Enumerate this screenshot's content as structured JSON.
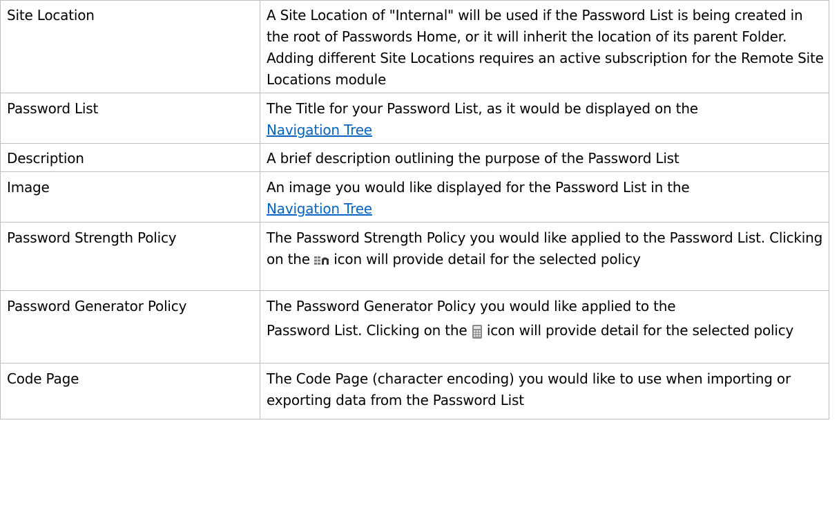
{
  "rows": [
    {
      "field": "Site Location",
      "description": "A Site Location of \"Internal\" will be used if the Password List is being created in the root of Passwords Home, or it will inherit the location of its parent Folder. Adding different Site Locations requires an active subscription for the Remote Site Locations module"
    },
    {
      "field": "Password List",
      "description_before": "The Title for your Password List, as it would be displayed on the",
      "link": "Navigation Tree"
    },
    {
      "field": "Description",
      "description": "A brief description outlining the purpose of the Password List"
    },
    {
      "field": "Image",
      "description_before": "An image you would like displayed for the Password List in the",
      "link": "Navigation Tree"
    },
    {
      "field": "Password Strength Policy",
      "description_before": "The Password Strength Policy you would like applied to the Password List. Clicking on the",
      "icon": "strength-policy-icon",
      "description_after": "icon will provide detail for the selected policy"
    },
    {
      "field": "Password Generator Policy",
      "description_before": "The Password Generator Policy you would like applied to the",
      "description_before_2": "Password List. Clicking on the",
      "icon": "calculator-icon",
      "description_after": "icon will provide detail for the selected policy"
    },
    {
      "field": "Code Page",
      "description": "The Code Page (character encoding) you would like to use when importing or exporting data from the Password List"
    }
  ],
  "colors": {
    "border": "#bfbfbf",
    "link": "#0563c1",
    "text": "#000000"
  }
}
